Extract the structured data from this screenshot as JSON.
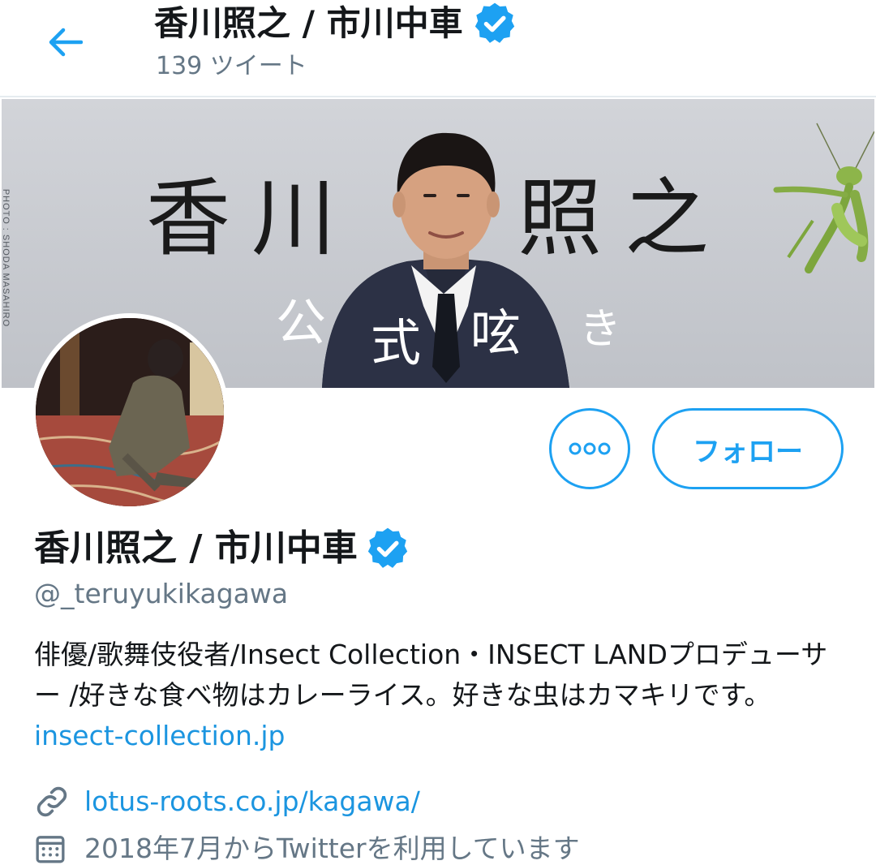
{
  "header": {
    "title": "香川照之 / 市川中車",
    "tweet_count": "139 ツイート"
  },
  "banner": {
    "photo_credit": "PHOTO : SHODA MASAHIRO",
    "name_chars": [
      "香",
      "川",
      "照",
      "之"
    ],
    "sub_chars": [
      "公",
      "式",
      "呟",
      "き"
    ]
  },
  "actions": {
    "more_label": "•••",
    "follow_label": "フォロー"
  },
  "profile": {
    "display_name": "香川照之 / 市川中車",
    "handle": "@_teruyukikagawa",
    "bio_text": "俳優/歌舞伎役者/Insect Collection・INSECT LANDプロデューサー /好きな食べ物はカレーライス。好きな虫はカマキリです。",
    "bio_link": "insect-collection.jp",
    "website": "lotus-roots.co.jp/kagawa/",
    "joined": "2018年7月からTwitterを利用しています"
  },
  "colors": {
    "accent": "#1da1f2",
    "link": "#1b95e0",
    "muted": "#657786"
  },
  "icons": {
    "back": "arrow-left-icon",
    "verified": "verified-badge-icon",
    "link": "link-icon",
    "calendar": "calendar-icon"
  }
}
